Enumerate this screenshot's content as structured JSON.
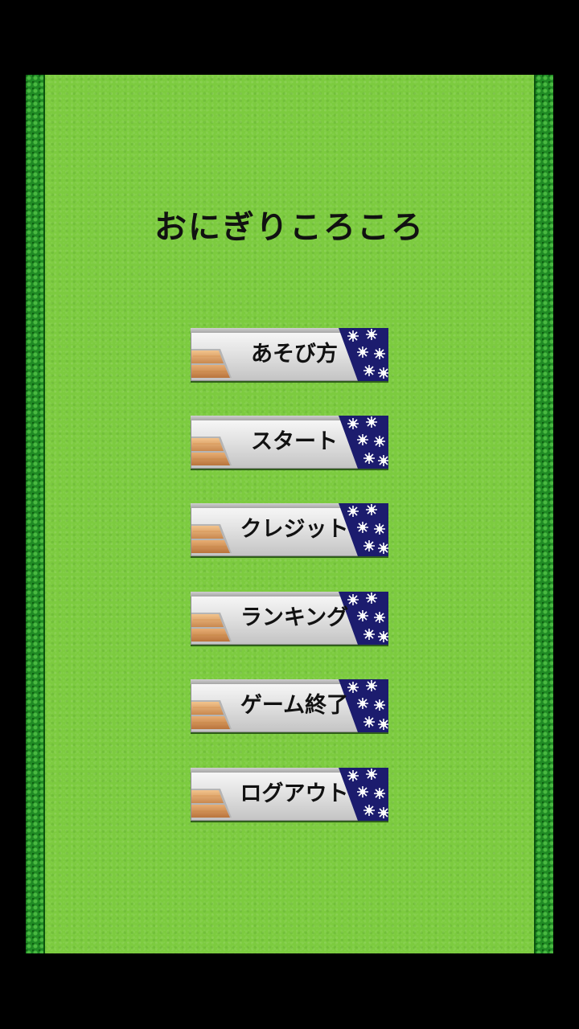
{
  "title": "おにぎりころころ",
  "menu": {
    "howto_label": "あそび方",
    "start_label": "スタート",
    "credit_label": "クレジット",
    "ranking_label": "ランキング",
    "exit_label": "ゲーム終了",
    "logout_label": "ログアウト"
  },
  "colors": {
    "background": "#000000",
    "grass": "#7ccb3f",
    "hedge": "#1f8a24",
    "star_panel": "#1c1c6e"
  }
}
